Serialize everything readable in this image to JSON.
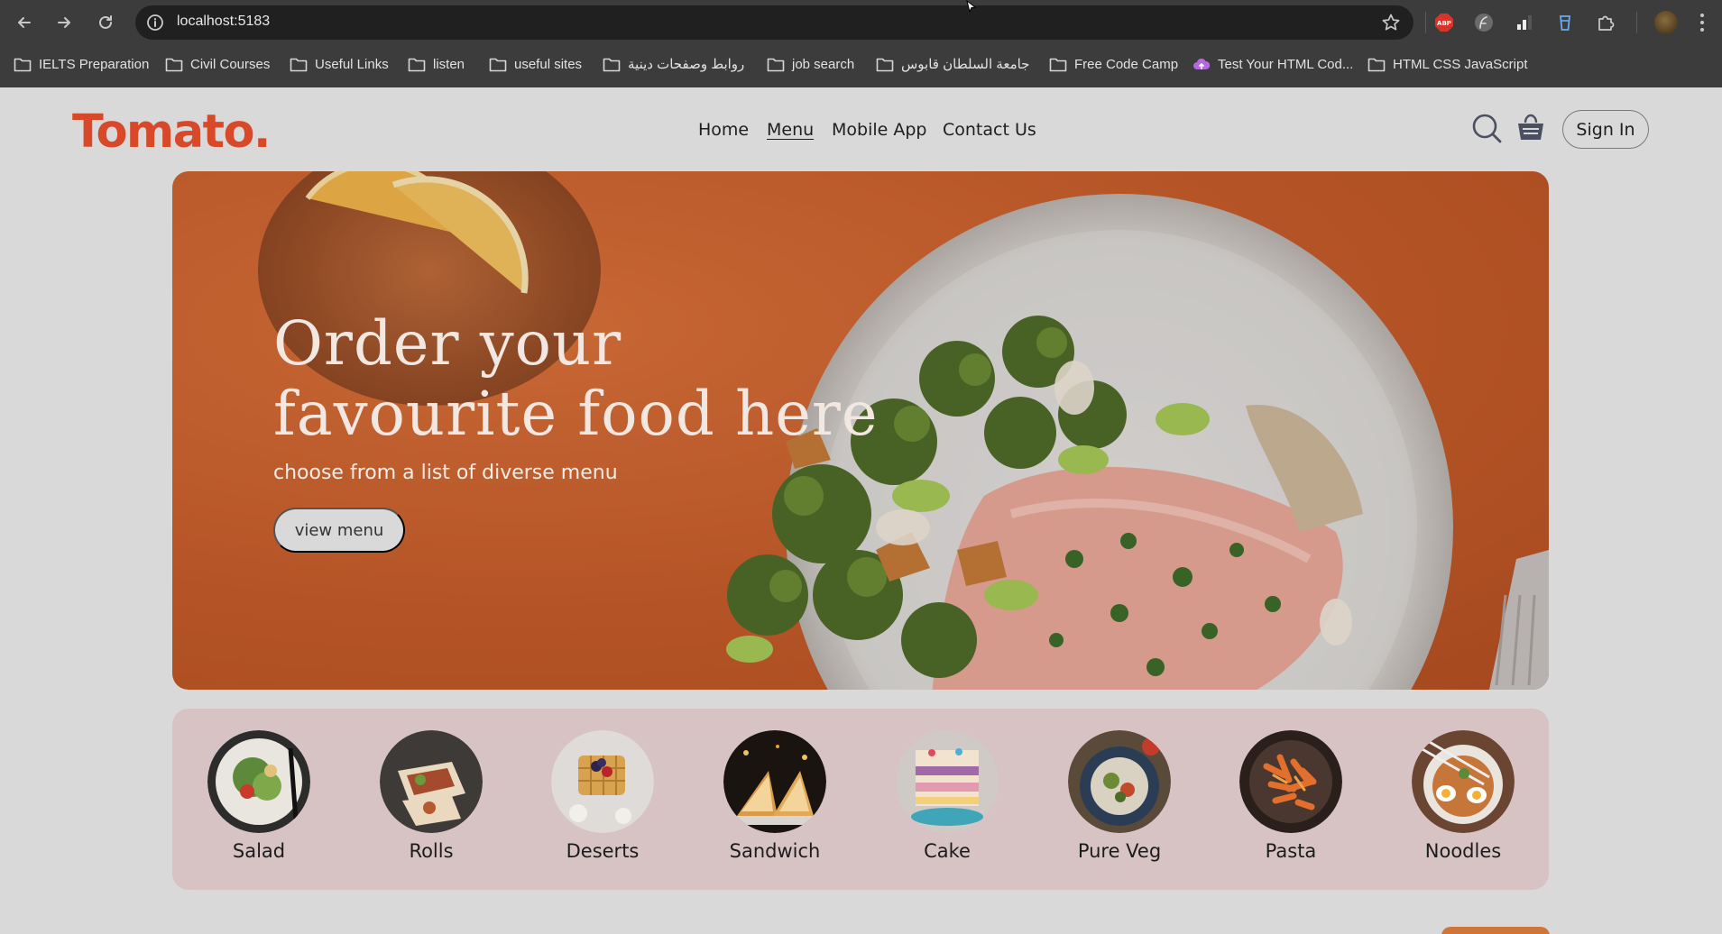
{
  "browser": {
    "url": "localhost:5183",
    "bookmarks": [
      {
        "label": "IELTS Preparation",
        "icon": "folder-icon"
      },
      {
        "label": "Civil Courses",
        "icon": "folder-icon"
      },
      {
        "label": "Useful Links",
        "icon": "folder-icon"
      },
      {
        "label": "listen",
        "icon": "folder-icon"
      },
      {
        "label": "useful sites",
        "icon": "folder-icon"
      },
      {
        "label": "روابط وصفحات دينية",
        "icon": "folder-icon"
      },
      {
        "label": "job search",
        "icon": "folder-icon"
      },
      {
        "label": "جامعة السلطان قابوس",
        "icon": "folder-icon"
      },
      {
        "label": "Free Code Camp",
        "icon": "folder-icon"
      },
      {
        "label": "Test Your HTML Cod...",
        "icon": "cloud-icon"
      },
      {
        "label": "HTML CSS JavaScript",
        "icon": "folder-icon"
      }
    ],
    "extensions": [
      "adblock-icon",
      "feather-icon",
      "signal-icon",
      "cup-icon",
      "puzzle-icon"
    ]
  },
  "site": {
    "logo": "Tomato.",
    "nav": [
      {
        "label": "Home",
        "active": false
      },
      {
        "label": "Menu",
        "active": true
      },
      {
        "label": "Mobile App",
        "active": false
      },
      {
        "label": "Contact Us",
        "active": false
      }
    ],
    "signin_label": "Sign In",
    "brand_color": "#d8492a"
  },
  "hero": {
    "title_line1": "Order your",
    "title_line2": "favourite food here",
    "subtitle": "choose from a list of diverse menu",
    "button_label": "view menu"
  },
  "categories": [
    {
      "label": "Salad"
    },
    {
      "label": "Rolls"
    },
    {
      "label": "Deserts"
    },
    {
      "label": "Sandwich"
    },
    {
      "label": "Cake"
    },
    {
      "label": "Pure Veg"
    },
    {
      "label": "Pasta"
    },
    {
      "label": "Noodles"
    }
  ]
}
